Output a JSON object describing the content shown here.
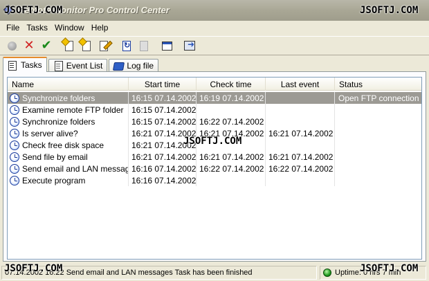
{
  "window": {
    "title": "Remote Monitor Pro Control Center"
  },
  "watermarks": {
    "top_left": "JSOFTJ.COM",
    "top_right": "JSOFTJ.COM",
    "middle": "JSOFTJ.COM",
    "bottom_left": "JSOFTJ.COM",
    "bottom_right": "JSOFTJ.COM"
  },
  "menu": [
    {
      "label": "File"
    },
    {
      "label": "Tasks"
    },
    {
      "label": "Window"
    },
    {
      "label": "Help"
    }
  ],
  "toolbar": {
    "buttons": [
      {
        "icon": "pause-circle-icon",
        "enabled": false
      },
      {
        "icon": "delete-x-icon",
        "enabled": true
      },
      {
        "icon": "check-icon",
        "enabled": true
      },
      {
        "icon": "new-task-icon",
        "enabled": true
      },
      {
        "icon": "copy-task-icon",
        "enabled": true
      },
      {
        "icon": "edit-task-icon",
        "enabled": true
      },
      {
        "icon": "refresh-task-icon",
        "enabled": true
      },
      {
        "icon": "blank-document-icon",
        "enabled": false
      },
      {
        "icon": "window-icon",
        "enabled": true
      },
      {
        "icon": "export-icon",
        "enabled": true
      }
    ]
  },
  "tabs": [
    {
      "label": "Tasks",
      "active": true
    },
    {
      "label": "Event List",
      "active": false
    },
    {
      "label": "Log file",
      "active": false
    }
  ],
  "table": {
    "columns": [
      "Name",
      "Start time",
      "Check time",
      "Last event",
      "Status"
    ],
    "rows": [
      {
        "name": "Synchronize folders",
        "start": "16:15  07.14.2002",
        "check": "16:19  07.14.2002",
        "last": "",
        "status": "Open FTP connection",
        "selected": true
      },
      {
        "name": "Examine remote FTP folder",
        "start": "16:15  07.14.2002",
        "check": "",
        "last": "",
        "status": ""
      },
      {
        "name": "Synchronize folders",
        "start": "16:15  07.14.2002",
        "check": "16:22  07.14.2002",
        "last": "",
        "status": ""
      },
      {
        "name": "Is server alive?",
        "start": "16:21  07.14.2002",
        "check": "16:21  07.14.2002",
        "last": "16:21  07.14.2002",
        "status": ""
      },
      {
        "name": "Check free disk space",
        "start": "16:21  07.14.2002",
        "check": "",
        "last": "",
        "status": ""
      },
      {
        "name": "Send file by email",
        "start": "16:21  07.14.2002",
        "check": "16:21  07.14.2002",
        "last": "16:21  07.14.2002",
        "status": ""
      },
      {
        "name": "Send email and LAN messages",
        "start": "16:16  07.14.2002",
        "check": "16:22  07.14.2002",
        "last": "16:22  07.14.2002",
        "status": ""
      },
      {
        "name": "Execute program",
        "start": "16:16  07.14.2002",
        "check": "",
        "last": "",
        "status": ""
      }
    ]
  },
  "statusbar": {
    "message": "07.14.2002  16:22  Send email and LAN messages Task has been finished",
    "uptime": "Uptime: 0 hrs 7 min"
  }
}
